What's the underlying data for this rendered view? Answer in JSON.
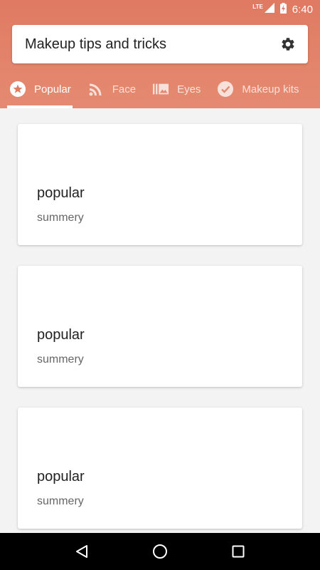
{
  "status_bar": {
    "network": "LTE",
    "time": "6:40"
  },
  "app_bar": {
    "title": "Makeup tips and tricks",
    "settings_icon": "gear-icon"
  },
  "tabs": [
    {
      "label": "Popular",
      "icon": "star-icon",
      "active": true
    },
    {
      "label": "Face",
      "icon": "rss-icon",
      "active": false
    },
    {
      "label": "Eyes",
      "icon": "gallery-icon",
      "active": false
    },
    {
      "label": "Makeup kits",
      "icon": "check-circle-icon",
      "active": false
    }
  ],
  "cards": [
    {
      "title": "popular",
      "summary": "summery"
    },
    {
      "title": "popular",
      "summary": "summery"
    },
    {
      "title": "popular",
      "summary": "summery"
    }
  ],
  "colors": {
    "header": "#e07a62",
    "nav_bar": "#000000"
  }
}
